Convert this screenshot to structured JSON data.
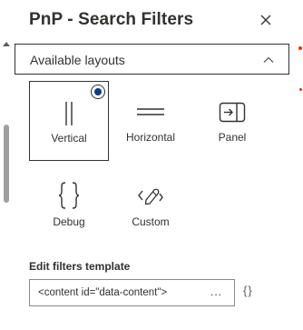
{
  "header": {
    "title": "PnP - Search Filters",
    "close_icon": "close-icon"
  },
  "accordion": {
    "label": "Available layouts",
    "expanded": true,
    "chevron_icon": "chevron-up-icon"
  },
  "layouts": [
    {
      "label": "Vertical",
      "icon": "vertical-lines-icon",
      "selected": true
    },
    {
      "label": "Horizontal",
      "icon": "horizontal-lines-icon",
      "selected": false
    },
    {
      "label": "Panel",
      "icon": "panel-icon",
      "selected": false
    },
    {
      "label": "Debug",
      "icon": "braces-icon",
      "selected": false
    },
    {
      "label": "Custom",
      "icon": "custom-edit-icon",
      "selected": false
    }
  ],
  "template": {
    "label": "Edit filters template",
    "value": "<content id=\"data-content\">",
    "ellipsis": "...",
    "braces_button": "{}"
  },
  "colors": {
    "text": "#323130",
    "accent": "#0f3a87",
    "border": "#8a8886",
    "side_accent": "#d83b01"
  }
}
